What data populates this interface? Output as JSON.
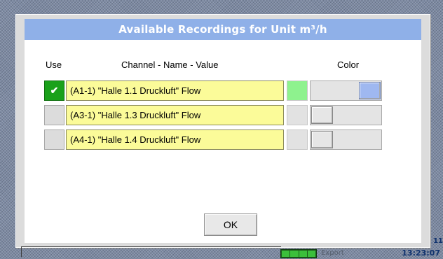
{
  "dialog": {
    "title": "Available Recordings for Unit m³/h",
    "headers": {
      "use": "Use",
      "channel": "Channel - Name - Value",
      "color": "Color"
    },
    "rows": [
      {
        "checked": true,
        "check_mark": "✔",
        "label": "(A1-1) \"Halle 1.1 Druckluft\" Flow",
        "swatch_color": "#8ef28e",
        "slider_level": 1.0
      },
      {
        "checked": false,
        "check_mark": "",
        "label": "(A3-1) \"Halle 1.3 Druckluft\" Flow",
        "swatch_color": "#e2e2e2",
        "slider_level": 0.0
      },
      {
        "checked": false,
        "check_mark": "",
        "label": "(A4-1) \"Halle 1.4 Druckluft\" Flow",
        "swatch_color": "#e2e2e2",
        "slider_level": 0.0
      }
    ],
    "ok_label": "OK"
  },
  "status": {
    "text": "Export",
    "clock": "13:23:07",
    "corner_text": "11"
  },
  "colors": {
    "title_bar": "#8fb0e8",
    "checked_green": "#1aa11a",
    "field_yellow": "#fbfb99",
    "knob_blue": "#9fb8f0"
  }
}
